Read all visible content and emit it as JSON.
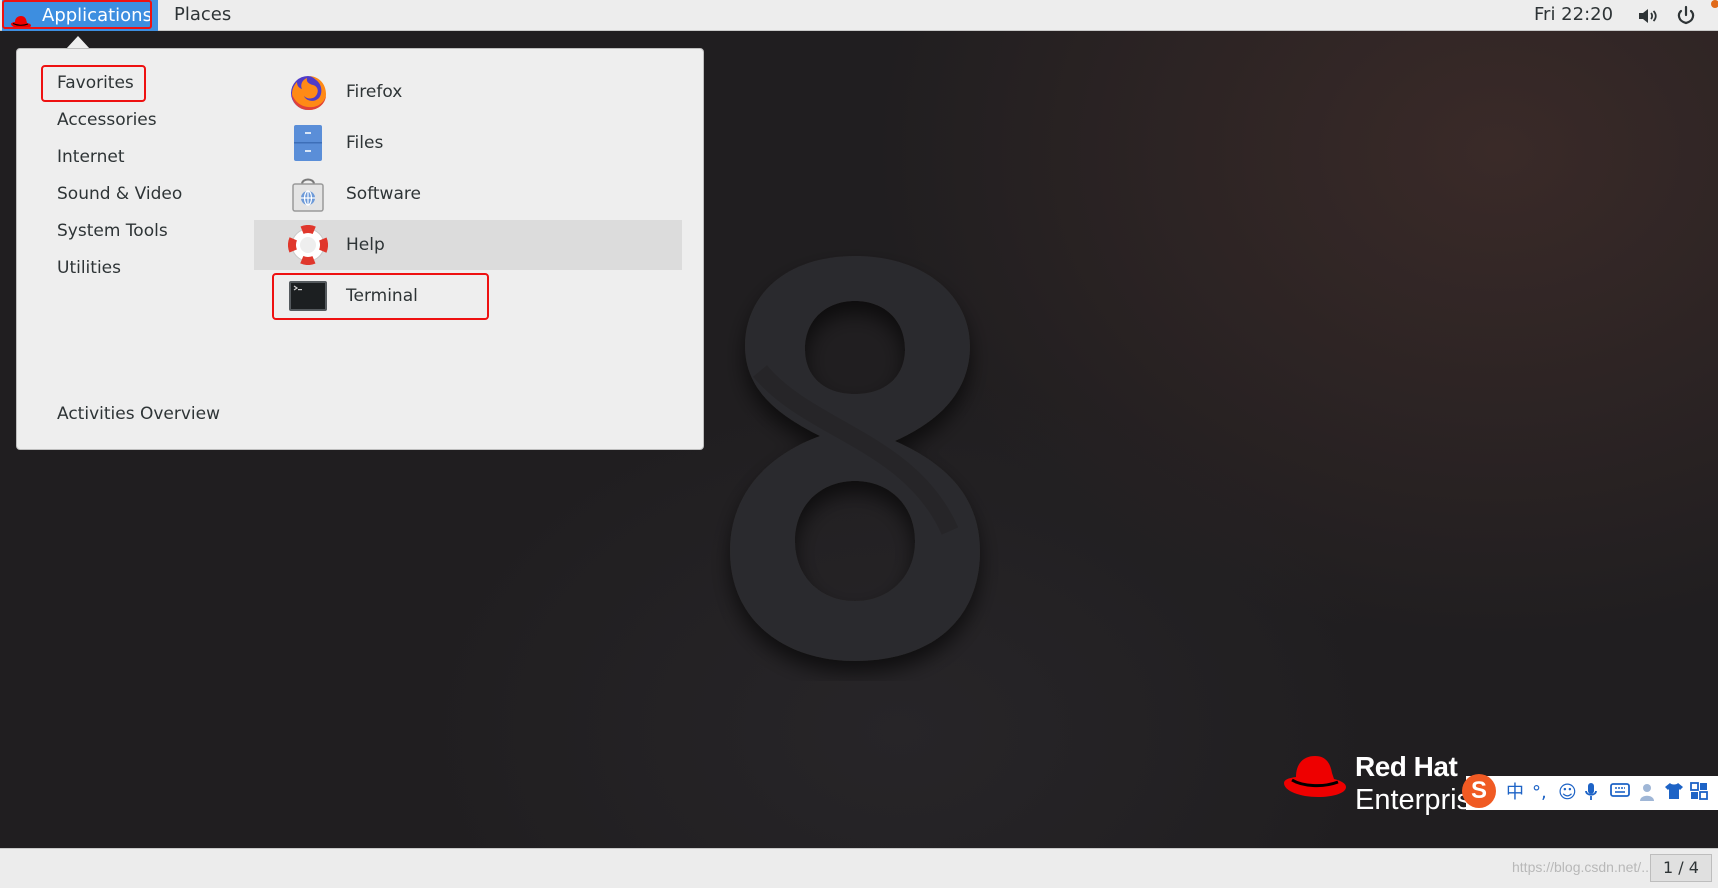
{
  "topbar": {
    "applications_label": "Applications",
    "places_label": "Places",
    "clock": "Fri 22:20"
  },
  "menu": {
    "categories": [
      "Favorites",
      "Accessories",
      "Internet",
      "Sound & Video",
      "System Tools",
      "Utilities"
    ],
    "activities_label": "Activities Overview",
    "apps": [
      {
        "label": "Firefox",
        "icon": "firefox-icon"
      },
      {
        "label": "Files",
        "icon": "files-icon"
      },
      {
        "label": "Software",
        "icon": "software-icon"
      },
      {
        "label": "Help",
        "icon": "help-icon"
      },
      {
        "label": "Terminal",
        "icon": "terminal-icon"
      }
    ],
    "hovered_app": "Help"
  },
  "desktop": {
    "wallpaper_numeral": "8",
    "logo_line1": "Red Hat",
    "logo_line2": "Enterprise Linux"
  },
  "ime": {
    "logo": "S",
    "items": [
      "中",
      "°,",
      "☺",
      "🎤",
      "⌨",
      "👤",
      "👕",
      "▦"
    ]
  },
  "bottombar": {
    "watermark": "https://blog.csdn.net/...",
    "workspace": "1 / 4"
  },
  "colors": {
    "highlight_box": "#ee1111",
    "topbar_active": "#3d8ee0",
    "redhat_red": "#ee0000"
  }
}
